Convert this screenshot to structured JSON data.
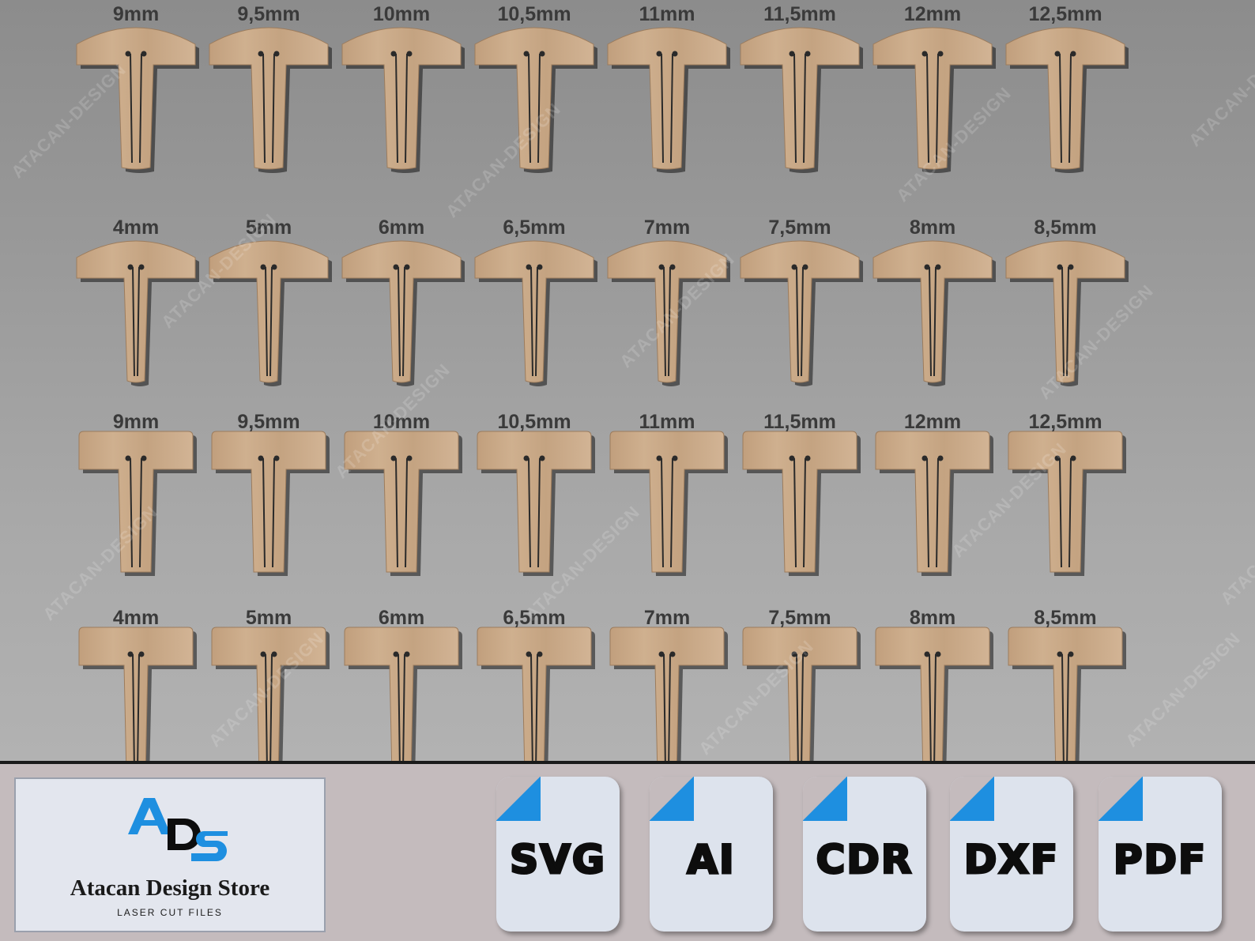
{
  "rows": [
    {
      "shape": "round",
      "labels": [
        "9mm",
        "9,5mm",
        "10mm",
        "10,5mm",
        "11mm",
        "11,5mm",
        "12mm",
        "12,5mm"
      ]
    },
    {
      "shape": "round",
      "labels": [
        "4mm",
        "5mm",
        "6mm",
        "6,5mm",
        "7mm",
        "7,5mm",
        "8mm",
        "8,5mm"
      ]
    },
    {
      "shape": "flat",
      "labels": [
        "9mm",
        "9,5mm",
        "10mm",
        "10,5mm",
        "11mm",
        "11,5mm",
        "12mm",
        "12,5mm"
      ]
    },
    {
      "shape": "flat",
      "labels": [
        "4mm",
        "5mm",
        "6mm",
        "6,5mm",
        "7mm",
        "7,5mm",
        "8mm",
        "8,5mm"
      ]
    }
  ],
  "watermark": "ATACAN-DESIGN",
  "colors": {
    "wood": "#c8a886",
    "wood_dark": "#b18d6c",
    "accent": "#1e8fe0",
    "background": "#9a9a9a"
  },
  "logo": {
    "mark": "ADS",
    "name": "Atacan Design Store",
    "tagline": "LASER CUT FILES"
  },
  "formats": [
    "SVG",
    "AI",
    "CDR",
    "DXF",
    "PDF"
  ]
}
